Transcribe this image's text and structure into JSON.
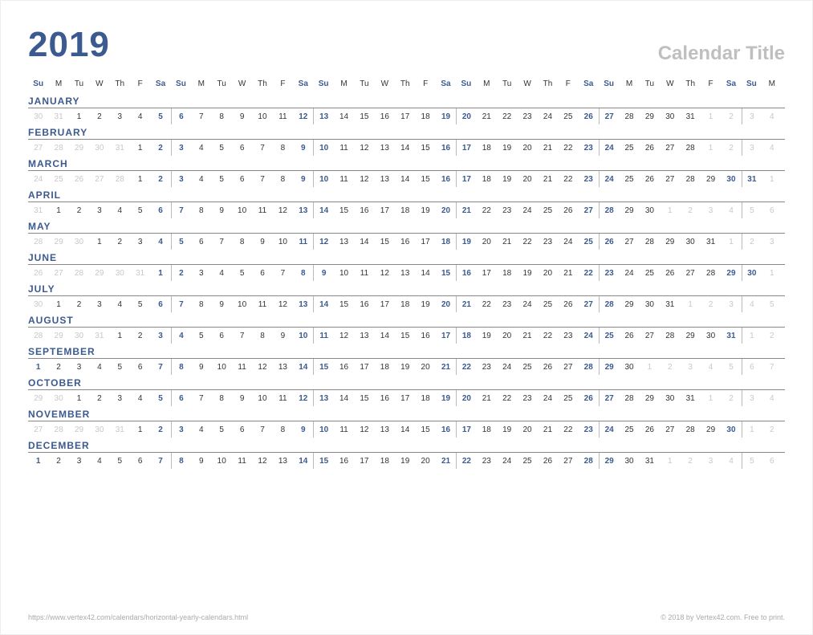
{
  "header": {
    "year": "2019",
    "title": "Calendar Title"
  },
  "dow": [
    "Su",
    "M",
    "Tu",
    "W",
    "Th",
    "F",
    "Sa",
    "Su",
    "M",
    "Tu",
    "W",
    "Th",
    "F",
    "Sa",
    "Su",
    "M",
    "Tu",
    "W",
    "Th",
    "F",
    "Sa",
    "Su",
    "M",
    "Tu",
    "W",
    "Th",
    "F",
    "Sa",
    "Su",
    "M",
    "Tu",
    "W",
    "Th",
    "F",
    "Sa",
    "Su",
    "M"
  ],
  "months": [
    {
      "name": "JANUARY",
      "lead_out": [
        "30",
        "31"
      ],
      "days": 31,
      "trail_out": [
        "1",
        "2",
        "3",
        "4"
      ]
    },
    {
      "name": "FEBRUARY",
      "lead_out": [
        "27",
        "28",
        "29",
        "30",
        "31"
      ],
      "days": 28,
      "trail_out": [
        "1",
        "2",
        "3",
        "4"
      ]
    },
    {
      "name": "MARCH",
      "lead_out": [
        "24",
        "25",
        "26",
        "27",
        "28"
      ],
      "days": 31,
      "trail_out": [
        "1"
      ]
    },
    {
      "name": "APRIL",
      "lead_out": [
        "31"
      ],
      "days": 30,
      "trail_out": [
        "1",
        "2",
        "3",
        "4",
        "5",
        "6"
      ]
    },
    {
      "name": "MAY",
      "lead_out": [
        "28",
        "29",
        "30"
      ],
      "days": 31,
      "trail_out": [
        "1",
        "2",
        "3"
      ]
    },
    {
      "name": "JUNE",
      "lead_out": [
        "26",
        "27",
        "28",
        "29",
        "30",
        "31"
      ],
      "days": 30,
      "trail_out": [
        "1"
      ]
    },
    {
      "name": "JULY",
      "lead_out": [
        "30"
      ],
      "days": 31,
      "trail_out": [
        "1",
        "2",
        "3",
        "4",
        "5"
      ]
    },
    {
      "name": "AUGUST",
      "lead_out": [
        "28",
        "29",
        "30",
        "31"
      ],
      "days": 31,
      "trail_out": [
        "1",
        "2"
      ]
    },
    {
      "name": "SEPTEMBER",
      "lead_out": [],
      "days": 30,
      "trail_out": [
        "1",
        "2",
        "3",
        "4",
        "5",
        "6",
        "7"
      ]
    },
    {
      "name": "OCTOBER",
      "lead_out": [
        "29",
        "30"
      ],
      "days": 31,
      "trail_out": [
        "1",
        "2",
        "3",
        "4"
      ]
    },
    {
      "name": "NOVEMBER",
      "lead_out": [
        "27",
        "28",
        "29",
        "30",
        "31"
      ],
      "days": 30,
      "trail_out": [
        "1",
        "2"
      ]
    },
    {
      "name": "DECEMBER",
      "lead_out": [],
      "days": 31,
      "trail_out": [
        "1",
        "2",
        "3",
        "4",
        "5",
        "6"
      ]
    }
  ],
  "footer": {
    "left": "https://www.vertex42.com/calendars/horizontal-yearly-calendars.html",
    "right": "© 2018 by Vertex42.com. Free to print."
  }
}
